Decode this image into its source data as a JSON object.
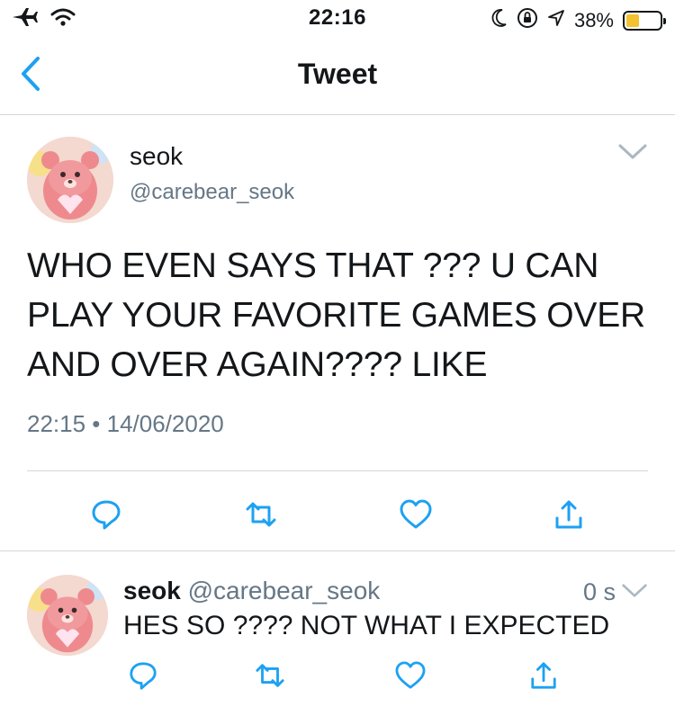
{
  "status_bar": {
    "time": "22:16",
    "battery_percent": "38%",
    "battery_level": 0.38,
    "icons": [
      "airplane-icon",
      "wifi-icon",
      "moon-icon",
      "orientation-lock-icon",
      "location-icon",
      "battery-icon"
    ]
  },
  "nav": {
    "title": "Tweet",
    "back_icon": "chevron-left-icon"
  },
  "tweet": {
    "name": "seok",
    "handle": "@carebear_seok",
    "text": "WHO EVEN SAYS THAT ??? U CAN PLAY YOUR FAVORITE GAMES OVER AND OVER AGAIN???? LIKE",
    "timestamp": "22:15 • 14/06/2020",
    "actions": [
      "reply-icon",
      "retweet-icon",
      "like-icon",
      "share-icon"
    ]
  },
  "reply": {
    "name": "seok",
    "handle": "@carebear_seok",
    "time": "0 s",
    "text": "HES SO ???? NOT WHAT I EXPECTED",
    "actions": [
      "reply-icon",
      "retweet-icon",
      "like-icon",
      "share-icon"
    ]
  },
  "colors": {
    "twitter_blue": "#1da1f2",
    "secondary_text": "#657786",
    "divider": "#d3d7db",
    "battery_fill": "#f2c230"
  }
}
